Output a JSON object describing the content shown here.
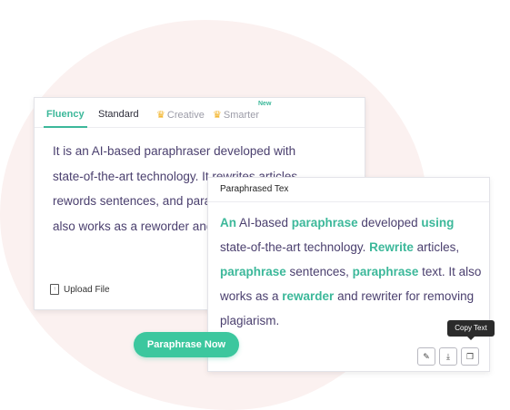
{
  "tabs": [
    {
      "label": "Fluency",
      "active": true
    },
    {
      "label": "Standard"
    },
    {
      "label": "Creative",
      "premium": true
    },
    {
      "label": "Smarter",
      "premium": true
    }
  ],
  "new_badge": "New",
  "input": {
    "lines": [
      "It is an AI-based paraphraser developed with",
      "state-of-the-art technology. It rewrites articles,",
      "rewords sentences, and paraphrases text. It",
      "also works as a reworder and rewriter for"
    ],
    "upload_label": "Upload File"
  },
  "output": {
    "header": "Paraphrased Tex",
    "segments": [
      {
        "text": "An",
        "hl": true
      },
      {
        "text": " AI-based "
      },
      {
        "text": "paraphrase",
        "hl": true
      },
      {
        "text": " developed "
      },
      {
        "text": "using",
        "hl": true
      },
      {
        "text": " state-of-the-art technology. "
      },
      {
        "text": "Rewrite",
        "hl": true
      },
      {
        "text": " articles, "
      },
      {
        "text": "paraphrase",
        "hl": true
      },
      {
        "text": " sentences, "
      },
      {
        "text": "paraphrase",
        "hl": true
      },
      {
        "text": " text. It also works as a "
      },
      {
        "text": "rewarder",
        "hl": true
      },
      {
        "text": " and rewriter for removing plagiarism."
      }
    ],
    "tooltip": "Copy Text"
  },
  "paraphrase_button": "Paraphrase Now",
  "icons": {
    "crown": "crown-icon",
    "file": "file-icon",
    "edit": "pencil-icon",
    "download": "download-icon",
    "copy": "copy-icon"
  },
  "colors": {
    "accent": "#3cb89a",
    "text": "#4a3f6e",
    "blob": "#fbf1f0"
  }
}
